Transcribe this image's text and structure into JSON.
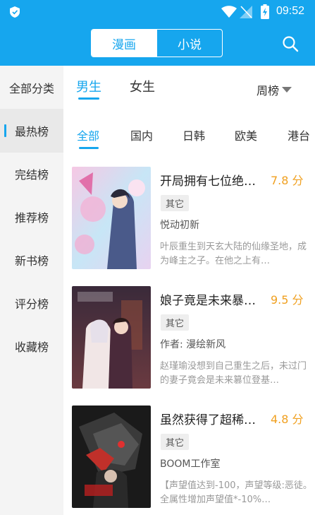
{
  "status_bar": {
    "time": "09:52"
  },
  "header": {
    "segments": [
      "漫画",
      "小说"
    ],
    "active_segment": 0,
    "search_icon": "search-icon"
  },
  "sidebar": {
    "items": [
      {
        "label": "全部分类"
      },
      {
        "label": "最热榜"
      },
      {
        "label": "完结榜"
      },
      {
        "label": "推荐榜"
      },
      {
        "label": "新书榜"
      },
      {
        "label": "评分榜"
      },
      {
        "label": "收藏榜"
      }
    ],
    "active_index": 1
  },
  "filters": {
    "gender_tabs": [
      "男生",
      "女生"
    ],
    "active_gender": 0,
    "rank_period": "周榜",
    "region_tabs": [
      "全部",
      "国内",
      "日韩",
      "欧美",
      "港台"
    ],
    "active_region": 0
  },
  "books": [
    {
      "title": "开局拥有七位绝…",
      "score": "7.8 分",
      "tag": "其它",
      "author": "悦动初新",
      "desc": "叶辰重生到天玄大陆的仙缘圣地，成为峰主之子。在他之上有…"
    },
    {
      "title": "娘子竟是未来暴…",
      "score": "9.5 分",
      "tag": "其它",
      "author": "作者: 漫绘新风",
      "desc": "赵瑾瑜没想到自己重生之后，未过门的妻子竟会是未来篡位登基…"
    },
    {
      "title": "虽然获得了超稀…",
      "score": "4.8 分",
      "tag": "其它",
      "author": "BOOM工作室",
      "desc": "【声望值达到-100，声望等级:恶徒。全属性增加声望值*-10%…"
    }
  ],
  "colors": {
    "brand": "#16A6EE",
    "score": "#F0A020"
  }
}
